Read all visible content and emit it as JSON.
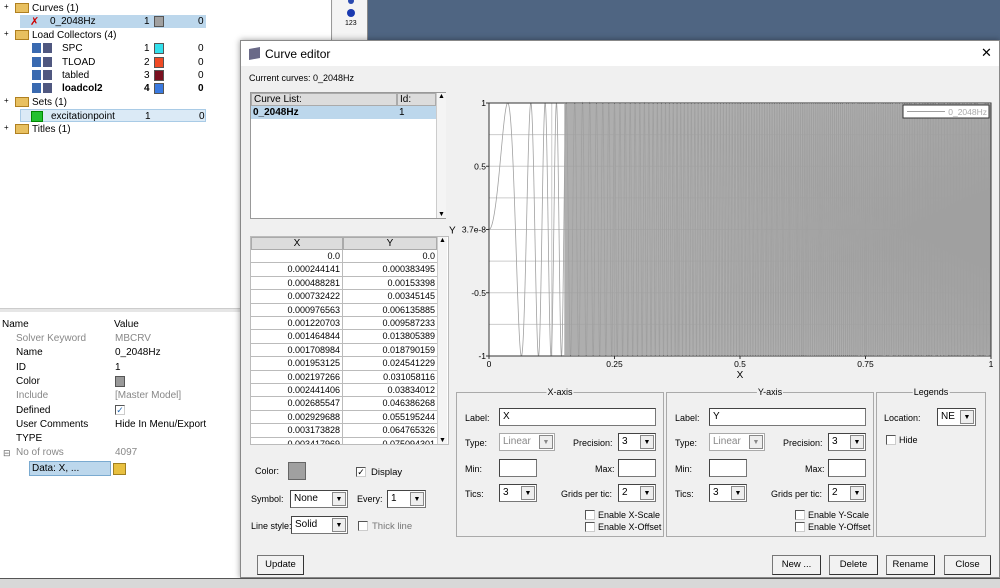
{
  "tree": {
    "items": [
      {
        "label": "Curves (1)",
        "type": "folder"
      },
      {
        "label": "0_2048Hz",
        "id": "1",
        "color": "#a0a0a0",
        "value": "0",
        "selected": true
      },
      {
        "label": "Load Collectors (4)",
        "type": "folder"
      },
      {
        "label": "SPC",
        "id": "1",
        "color": "#33e0ec",
        "value": "0"
      },
      {
        "label": "TLOAD",
        "id": "2",
        "color": "#f04a25",
        "value": "0"
      },
      {
        "label": "tabled",
        "id": "3",
        "color": "#7a1020",
        "value": "0"
      },
      {
        "label": "loadcol2",
        "id": "4",
        "color": "#3a7ae0",
        "value": "0",
        "bold": true
      },
      {
        "label": "Sets (1)",
        "type": "folder"
      },
      {
        "label": "excitationpoint",
        "id": "1",
        "value": "0"
      },
      {
        "label": "Titles (1)",
        "type": "folder"
      }
    ]
  },
  "properties": {
    "header_name": "Name",
    "header_value": "Value",
    "rows": [
      {
        "name": "Solver Keyword",
        "value": "MBCRV",
        "grey": true
      },
      {
        "name": "Name",
        "value": "0_2048Hz"
      },
      {
        "name": "ID",
        "value": "1"
      },
      {
        "name": "Color",
        "value": ""
      },
      {
        "name": "Include",
        "value": "[Master Model]",
        "grey": true
      },
      {
        "name": "Defined",
        "value": ""
      },
      {
        "name": "User Comments",
        "value": "Hide In Menu/Export"
      },
      {
        "name": "TYPE",
        "value": ""
      },
      {
        "name": "No of rows",
        "value": "4097",
        "grey": true
      }
    ],
    "data_cell": "Data: X, ..."
  },
  "toolstrip": {
    "label": "123"
  },
  "dialog": {
    "title": "Curve editor",
    "close": "✕",
    "current_curves": "Current curves: 0_2048Hz",
    "curve_list": {
      "header_name": "Curve List:",
      "header_id": "Id:",
      "rows": [
        {
          "name": "0_2048Hz",
          "id": "1"
        }
      ]
    },
    "xy_table": {
      "header_x": "X",
      "header_y": "Y",
      "rows": [
        [
          "0.0",
          "0.0"
        ],
        [
          "0.000244141",
          "0.000383495"
        ],
        [
          "0.000488281",
          "0.00153398"
        ],
        [
          "0.000732422",
          "0.00345145"
        ],
        [
          "0.000976563",
          "0.006135885"
        ],
        [
          "0.001220703",
          "0.009587233"
        ],
        [
          "0.001464844",
          "0.013805389"
        ],
        [
          "0.001708984",
          "0.018790159"
        ],
        [
          "0.001953125",
          "0.024541229"
        ],
        [
          "0.002197266",
          "0.031058116"
        ],
        [
          "0.002441406",
          "0.03834012"
        ],
        [
          "0.002685547",
          "0.046386268"
        ],
        [
          "0.002929688",
          "0.055195244"
        ],
        [
          "0.003173828",
          "0.064765326"
        ],
        [
          "0.003417969",
          "0.075094301"
        ]
      ]
    },
    "color_label": "Color:",
    "curve_color": "#a0a0a0",
    "display_label": "Display",
    "display_checked": true,
    "symbol_label": "Symbol:",
    "symbol_value": "None",
    "every_label": "Every:",
    "every_value": "1",
    "linestyle_label": "Line style:",
    "linestyle_value": "Solid",
    "thick_label": "Thick line",
    "thick_checked": false,
    "update": "Update",
    "xaxis": {
      "title": "X-axis",
      "label_label": "Label:",
      "label_value": "X",
      "type_label": "Type:",
      "type_value": "Linear",
      "precision_label": "Precision:",
      "precision_value": "3",
      "min_label": "Min:",
      "max_label": "Max:",
      "tics_label": "Tics:",
      "tics_value": "3",
      "grids_label": "Grids per tic:",
      "grids_value": "2",
      "scale": "Enable X-Scale",
      "offset": "Enable X-Offset"
    },
    "yaxis": {
      "title": "Y-axis",
      "label_label": "Label:",
      "label_value": "Y",
      "type_label": "Type:",
      "type_value": "Linear",
      "precision_label": "Precision:",
      "precision_value": "3",
      "min_label": "Min:",
      "max_label": "Max:",
      "tics_label": "Tics:",
      "tics_value": "3",
      "grids_label": "Grids per tic:",
      "grids_value": "2",
      "scale": "Enable Y-Scale",
      "offset": "Enable Y-Offset"
    },
    "legends": {
      "title": "Legends",
      "location_label": "Location:",
      "location_value": "NE",
      "hide": "Hide"
    },
    "buttons": {
      "new": "New ...",
      "delete": "Delete",
      "rename": "Rename",
      "close": "Close"
    }
  },
  "chart_data": {
    "type": "line",
    "xlabel": "X",
    "ylabel": "Y",
    "xlim": [
      0,
      1
    ],
    "ylim": [
      -1,
      1
    ],
    "xticks": [
      "0",
      "0.25",
      "0.5",
      "0.75",
      "1"
    ],
    "yticks": [
      "1",
      "0.5",
      "3.7e-8",
      "-0.5",
      "-1"
    ],
    "grid": true,
    "legend": {
      "placement": "top-right",
      "entries": [
        "0_2048Hz"
      ]
    },
    "series": [
      {
        "name": "0_2048Hz",
        "color": "#a0a0a0"
      }
    ]
  }
}
